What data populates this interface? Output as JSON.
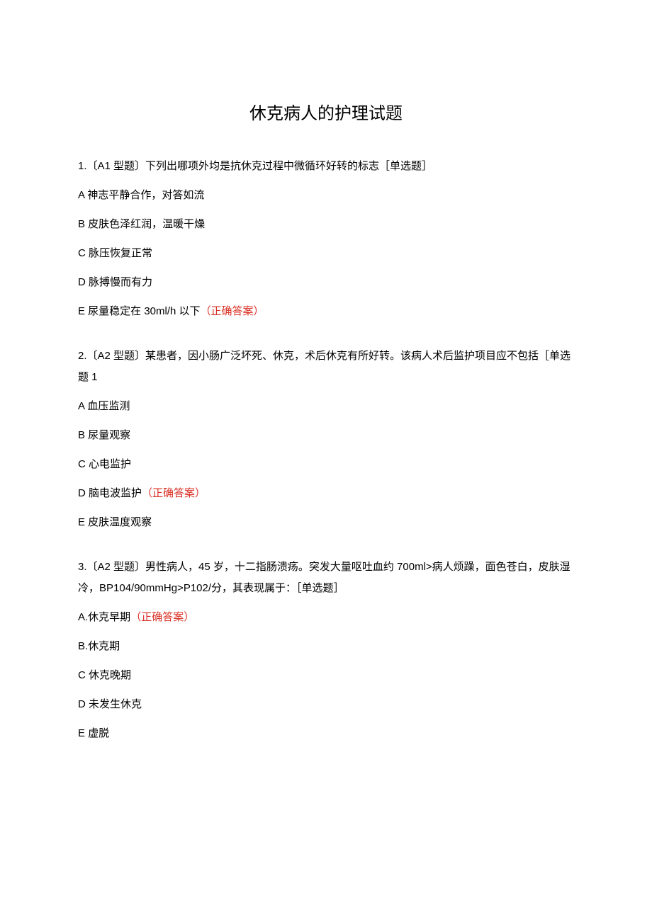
{
  "title": "休克病人的护理试题",
  "questions": [
    {
      "text": "1.〔A1 型题〕下列出哪项外均是抗休克过程中微循环好转的标志［单选题］",
      "options": [
        {
          "label": "A 神志平静合作，对答如流",
          "correct": false
        },
        {
          "label": "B 皮肤色泽红润，温暖干燥",
          "correct": false
        },
        {
          "label": "C 脉压恢复正常",
          "correct": false
        },
        {
          "label": "D 脉搏慢而有力",
          "correct": false
        },
        {
          "label": "E 尿量稳定在 30ml/h 以下",
          "correct": true
        }
      ]
    },
    {
      "text": "2.〔A2 型题〕某患者，因小肠广泛坏死、休克，术后休克有所好转。该病人术后监护项目应不包括［单选题 1",
      "options": [
        {
          "label": "A 血压监测",
          "correct": false
        },
        {
          "label": "B 尿量观察",
          "correct": false
        },
        {
          "label": "C 心电监护",
          "correct": false
        },
        {
          "label": "D 脑电波监护",
          "correct": true
        },
        {
          "label": "E 皮肤温度观察",
          "correct": false
        }
      ]
    },
    {
      "text": "3.〔A2 型题〕男性病人，45 岁，十二指肠溃疡。突发大量呕吐血约 700ml>病人烦躁，面色苍白，皮肤湿冷，BP104/90mmHg>P102/分，其表现属于：［单选题］",
      "options": [
        {
          "label": "A.休克早期",
          "correct": true
        },
        {
          "label": "B.休克期",
          "correct": false
        },
        {
          "label": "C 休克晚期",
          "correct": false
        },
        {
          "label": "D 未发生休克",
          "correct": false
        },
        {
          "label": "E 虚脱",
          "correct": false
        }
      ]
    }
  ],
  "correctLabel": "（正确答案）"
}
